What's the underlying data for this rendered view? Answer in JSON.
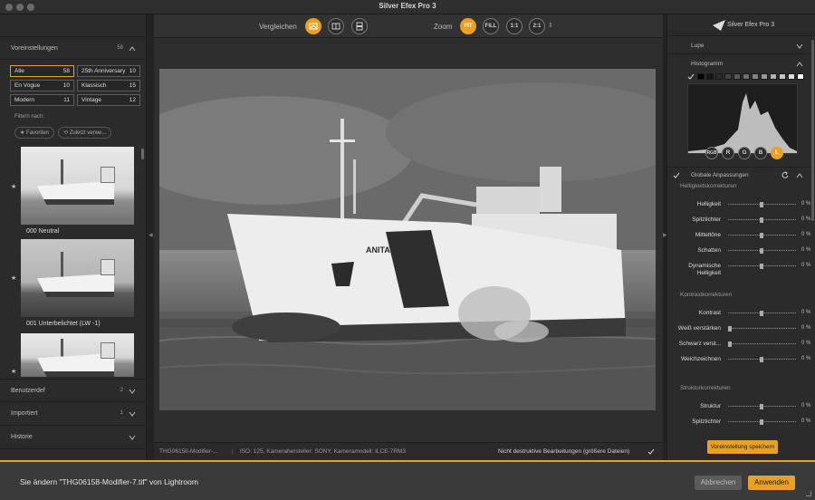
{
  "window": {
    "title": "Silver Efex Pro 3"
  },
  "left": {
    "presets": {
      "label": "Voreinstellungen",
      "count": "58"
    },
    "categories": [
      {
        "name": "Alle",
        "count": "58",
        "active": true
      },
      {
        "name": "25th Anniversary",
        "count": "10"
      },
      {
        "name": "En Vogue",
        "count": "10"
      },
      {
        "name": "Klassisch",
        "count": "15"
      },
      {
        "name": "Modern",
        "count": "11"
      },
      {
        "name": "Vintage",
        "count": "12"
      }
    ],
    "filter_label": "Filtern nach:",
    "filter_pills": [
      "★ Favoriten",
      "⟲ Zuletzt verwe..."
    ],
    "thumbs": [
      {
        "caption": "000 Neutral"
      },
      {
        "caption": "001 Unterbelichtet (LW -1)"
      },
      {
        "caption": ""
      }
    ],
    "bottom_sections": [
      {
        "label": "Benutzerdef",
        "count": "2"
      },
      {
        "label": "Importiert",
        "count": "1"
      },
      {
        "label": "Historie",
        "count": ""
      }
    ]
  },
  "toolbar": {
    "compare_label": "Vergleichen",
    "zoom_label": "Zoom",
    "zoom_buttons": [
      "FIT",
      "FILL",
      "1:1",
      "2:1"
    ]
  },
  "photo": {
    "ship_name": "ANITA"
  },
  "status": {
    "filename": "THG06158-Modifier-...",
    "meta": "ISO: 125, Kamerahersteller: SONY, Kameramodell: ILCE-7RM3",
    "nondestructive": "Nicht destruktive Bearbeitungen (größere Dateien)"
  },
  "right": {
    "brand": "Silver Efex Pro 3",
    "loupe": "Lupe",
    "histogram": "Histogramm",
    "channels": [
      "RGB",
      "R",
      "G",
      "B",
      "L"
    ],
    "global": "Globale Anpassungen",
    "groups": [
      {
        "title": "Helligkeitskorrekturen",
        "sliders": [
          {
            "label": "Helligkeit",
            "value": "0 %",
            "pos": 0.5
          },
          {
            "label": "Spitzlichter",
            "value": "0 %",
            "pos": 0.5
          },
          {
            "label": "Mitteltöne",
            "value": "0 %",
            "pos": 0.5
          },
          {
            "label": "Schatten",
            "value": "0 %",
            "pos": 0.5
          },
          {
            "label": "Dynamische Helligkeit",
            "value": "0 %",
            "pos": 0.5
          }
        ]
      },
      {
        "title": "Kontrastkorrekturen",
        "sliders": [
          {
            "label": "Kontrast",
            "value": "0 %",
            "pos": 0.5
          },
          {
            "label": "Weiß verstärken",
            "value": "0 %",
            "pos": 0.0
          },
          {
            "label": "Schwarz verst...",
            "value": "0 %",
            "pos": 0.0
          },
          {
            "label": "Weichzeichnen",
            "value": "0 %",
            "pos": 0.5
          }
        ]
      },
      {
        "title": "Strukturkorrekturen",
        "sliders": [
          {
            "label": "Struktur",
            "value": "0 %",
            "pos": 0.5
          },
          {
            "label": "Spitzlichter",
            "value": "0 %",
            "pos": 0.5
          }
        ]
      }
    ],
    "save_preset": "Voreinstellung speichern"
  },
  "bottom": {
    "message": "Sie ändern \"THG06158-Modifier-7.tif\" von Lightroom",
    "cancel": "Abbrechen",
    "apply": "Anwenden"
  },
  "colors": {
    "accent": "#e8a126",
    "panel": "#2b2b2b"
  }
}
